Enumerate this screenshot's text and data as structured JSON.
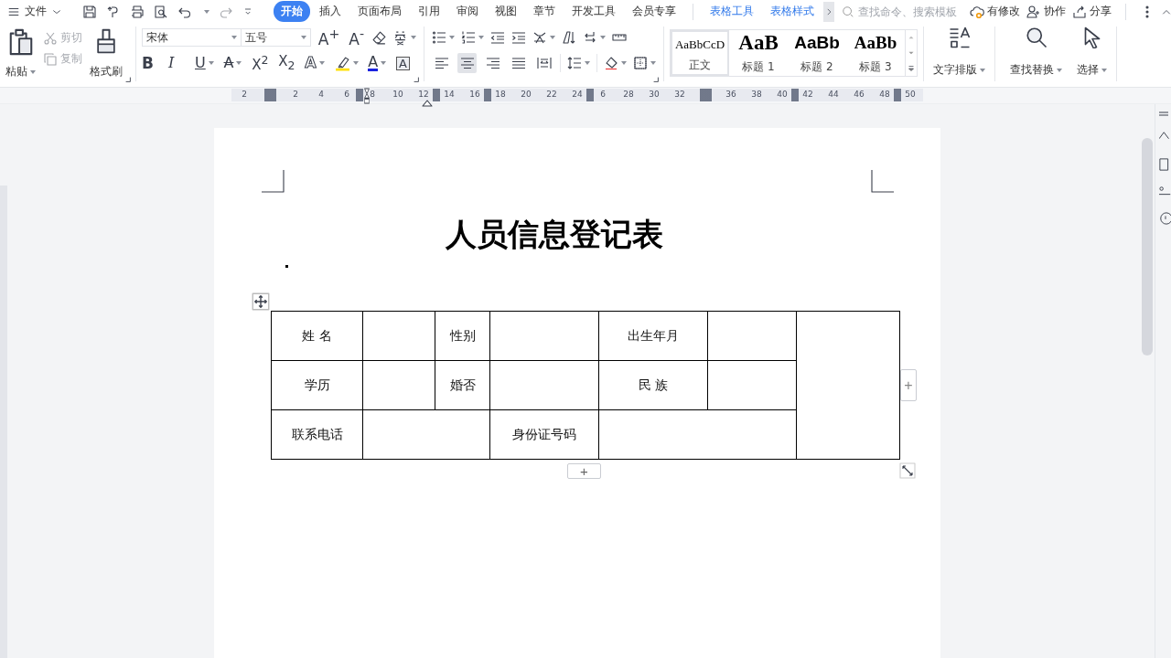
{
  "menu": {
    "label": "文件"
  },
  "tabs": [
    {
      "label": "开始",
      "selected": true
    },
    {
      "label": "插入",
      "selected": false
    },
    {
      "label": "页面布局",
      "selected": false
    },
    {
      "label": "引用",
      "selected": false
    },
    {
      "label": "审阅",
      "selected": false
    },
    {
      "label": "视图",
      "selected": false
    },
    {
      "label": "章节",
      "selected": false
    },
    {
      "label": "开发工具",
      "selected": false
    },
    {
      "label": "会员专享",
      "selected": false
    }
  ],
  "context_tabs": [
    {
      "label": "表格工具"
    },
    {
      "label": "表格样式"
    }
  ],
  "search": {
    "placeholder": "查找命令、搜索模板"
  },
  "actions": [
    {
      "label": "有修改",
      "kind": "cloud"
    },
    {
      "label": "协作",
      "kind": "people"
    },
    {
      "label": "分享",
      "kind": "share"
    }
  ],
  "clipboard": {
    "paste": "粘贴",
    "cut": {
      "label": "剪切",
      "disabled": true
    },
    "copy": {
      "label": "复制",
      "disabled": true
    },
    "painter": "格式刷"
  },
  "font": {
    "family": "宋体",
    "size": "五号",
    "grow": "A$^{+}$",
    "shrink": "A$^{-}$"
  },
  "font_buttons": [
    {
      "kind": "bold",
      "glyph": "B"
    },
    {
      "kind": "italic",
      "glyph": "I"
    },
    {
      "kind": "underline",
      "glyph": "U"
    },
    {
      "kind": "strike",
      "glyph": "A"
    },
    {
      "kind": "sup",
      "glyph": "X$^{2}$"
    },
    {
      "kind": "sub",
      "glyph": "X$_{2}$"
    },
    {
      "kind": "outline",
      "glyph": "A"
    },
    {
      "kind": "highlight"
    },
    {
      "kind": "color",
      "glyph": "A"
    },
    {
      "kind": "boxed",
      "glyph": "A"
    }
  ],
  "align": [
    {
      "selected": false
    },
    {
      "selected": true
    },
    {
      "selected": false
    },
    {
      "selected": false
    },
    {
      "selected": false
    }
  ],
  "styles": [
    {
      "kind": "body",
      "preview": "AaBbCcD",
      "label": "正文",
      "selected": true
    },
    {
      "kind": "h1",
      "preview": "AaB",
      "label": "标题 1",
      "selected": false
    },
    {
      "kind": "h2",
      "preview": "AaBb",
      "label": "标题 2",
      "selected": false
    },
    {
      "kind": "h3",
      "preview": "AaBb",
      "label": "标题 3",
      "selected": false
    }
  ],
  "big_buttons": [
    {
      "kind": "layout",
      "label": "文字排版"
    },
    {
      "kind": "find",
      "label": "查找替换"
    },
    {
      "kind": "select",
      "label": "选择"
    }
  ],
  "ruler": [
    {
      "kind": "label",
      "text": "2"
    },
    {
      "kind": "block"
    },
    {
      "kind": "label",
      "text": "2"
    },
    {
      "kind": "label",
      "text": "4"
    },
    {
      "kind": "label",
      "text": "6"
    },
    {
      "kind": "marker"
    },
    {
      "kind": "label",
      "text": "8"
    },
    {
      "kind": "label",
      "text": "10"
    },
    {
      "kind": "label",
      "text": "12"
    },
    {
      "kind": "marker"
    },
    {
      "kind": "label",
      "text": "14"
    },
    {
      "kind": "label",
      "text": "16"
    },
    {
      "kind": "marker"
    },
    {
      "kind": "label",
      "text": "18"
    },
    {
      "kind": "label",
      "text": "20"
    },
    {
      "kind": "label",
      "text": "22"
    },
    {
      "kind": "label",
      "text": "24"
    },
    {
      "kind": "marker"
    },
    {
      "kind": "label",
      "text": "6"
    },
    {
      "kind": "label",
      "text": "28"
    },
    {
      "kind": "label",
      "text": "30"
    },
    {
      "kind": "label",
      "text": "32"
    },
    {
      "kind": "block"
    },
    {
      "kind": "label",
      "text": "36"
    },
    {
      "kind": "label",
      "text": "38"
    },
    {
      "kind": "label",
      "text": "40"
    },
    {
      "kind": "marker"
    },
    {
      "kind": "label",
      "text": "42"
    },
    {
      "kind": "label",
      "text": "44"
    },
    {
      "kind": "label",
      "text": "46"
    },
    {
      "kind": "label",
      "text": "48"
    },
    {
      "kind": "marker"
    },
    {
      "kind": "label",
      "text": "50"
    }
  ],
  "document": {
    "title": "人员信息登记表",
    "table": {
      "rows": [
        [
          {
            "kind": "cell",
            "text": "姓 名"
          },
          {
            "kind": "cell"
          },
          {
            "kind": "cell",
            "text": "性别"
          },
          {
            "kind": "cell"
          },
          {
            "kind": "cell",
            "text": "出生年月"
          },
          {
            "kind": "cell"
          },
          {
            "kind": "tall"
          }
        ],
        [
          {
            "kind": "cell",
            "text": "学历"
          },
          {
            "kind": "cell"
          },
          {
            "kind": "cell",
            "text": "婚否"
          },
          {
            "kind": "cell"
          },
          {
            "kind": "cell",
            "text": "民 族"
          },
          {
            "kind": "cell"
          }
        ],
        [
          {
            "kind": "cell",
            "text": "联系电话"
          },
          {
            "kind": "wide"
          },
          {
            "kind": "cell",
            "text": "身份证号码"
          },
          {
            "kind": "wide"
          }
        ]
      ]
    },
    "add_row": "+",
    "add_column": "+"
  }
}
